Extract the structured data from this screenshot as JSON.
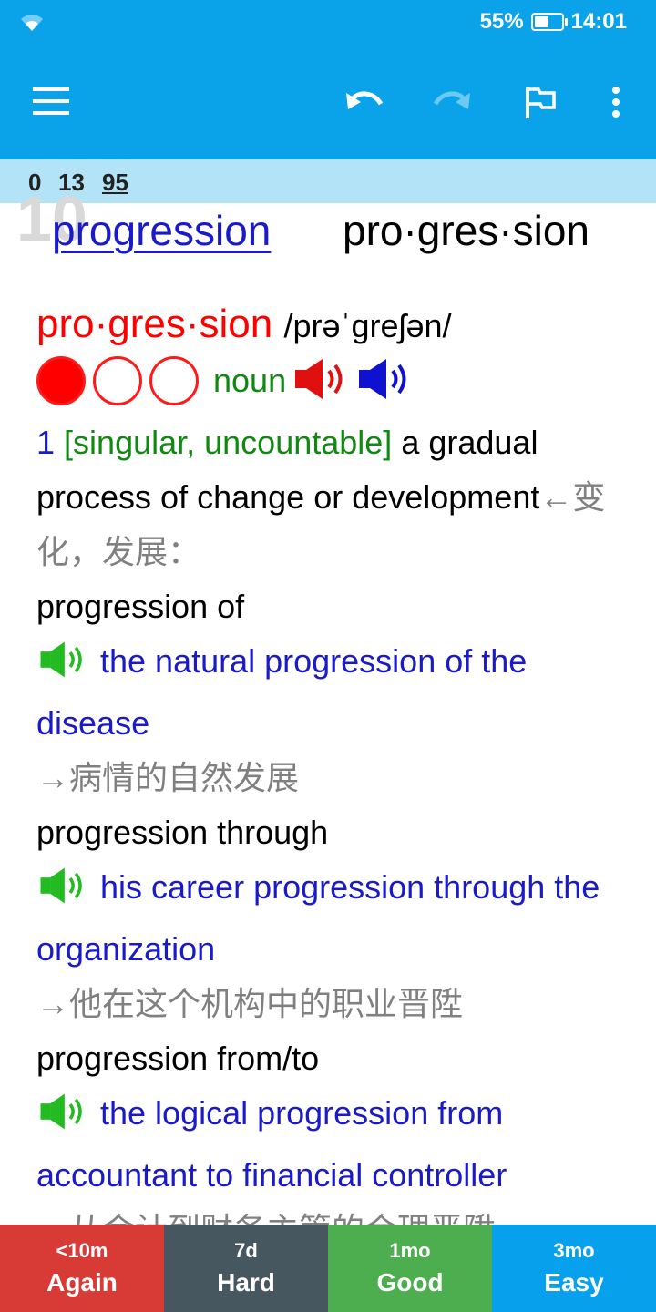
{
  "status_bar": {
    "battery": "55%",
    "time": "14:01",
    "battery_level": 0.55
  },
  "toolbar": {
    "menu_icon": "hamburger-menu-icon",
    "undo_icon": "undo-icon",
    "redo_icon": "redo-icon",
    "flag_icon": "flag-icon",
    "more_icon": "more-vertical-icon"
  },
  "counts": {
    "new": "0",
    "learning": "13",
    "review": "95"
  },
  "card": {
    "ghost_number": "10",
    "headword_link": "progression",
    "headword_syllables": "pro·gres·sion",
    "entry_syllables": "pro·gres·sion",
    "pronunciation": "/prəˈɡreʃən/",
    "frequency_level": 1,
    "part_of_speech": "noun",
    "sense_number": "1",
    "grammar": "[singular, uncountable]",
    "definition_en": "a gradual process of change or development",
    "definition_zh": "←变化，发展：",
    "examples": [
      {
        "pattern": "progression of",
        "sentence": "the natural progression of the disease",
        "translation": "→病情的自然发展"
      },
      {
        "pattern": "progression through",
        "sentence": "his career progression through the organization",
        "translation": "→他在这个机构中的职业晋陞"
      },
      {
        "pattern": "progression from/to",
        "sentence": "the logical progression from accountant to financial controller",
        "translation": "→从会计到财务主管的合理晋陞"
      }
    ]
  },
  "answers": [
    {
      "interval": "<10m",
      "label": "Again"
    },
    {
      "interval": "7d",
      "label": "Hard"
    },
    {
      "interval": "1mo",
      "label": "Good"
    },
    {
      "interval": "3mo",
      "label": "Easy"
    }
  ],
  "colors": {
    "toolbar": "#0aa3ea",
    "counts_strip": "#b3e3f7",
    "again": "#d83a36",
    "hard": "#475760",
    "good": "#4cae4f",
    "easy": "#07a0ec",
    "example_blue": "#1a1ac8",
    "grammar_green": "#118811",
    "syllable_red": "#ff0000"
  }
}
